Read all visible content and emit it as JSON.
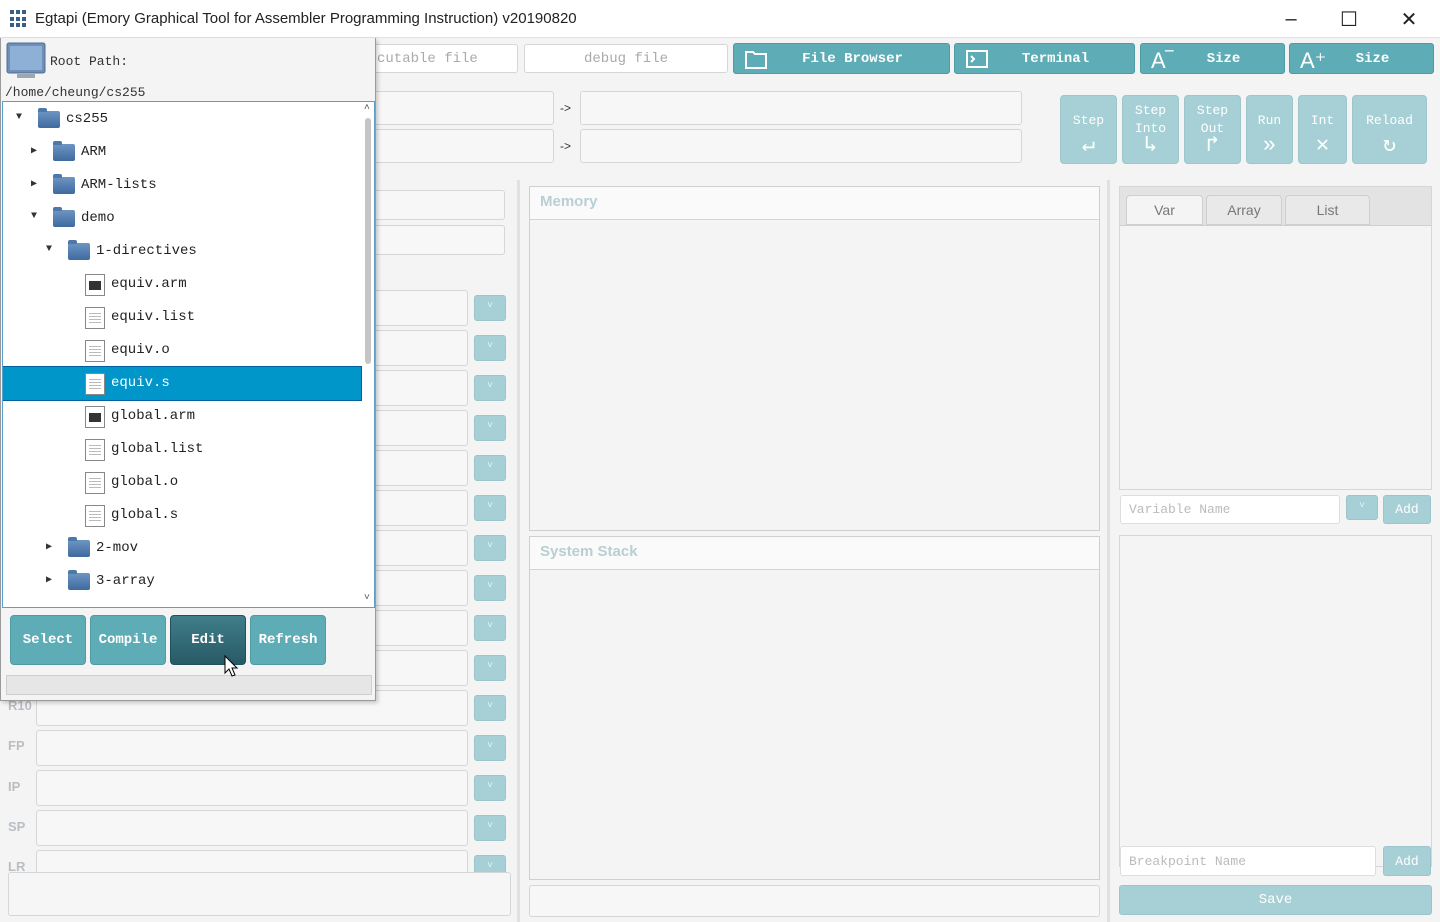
{
  "window": {
    "title": "Egtapi (Emory Graphical Tool for Assembler Programming Instruction) v20190820"
  },
  "toolbar": {
    "executable_placeholder": "cutable file",
    "debug_placeholder": "debug file",
    "file_browser": "File Browser",
    "terminal": "Terminal",
    "size_down": "Size",
    "size_up": "Size"
  },
  "arrows": [
    "->",
    "->"
  ],
  "controls": {
    "step": "Step",
    "step_into": "Step Into",
    "step_out": "Step Out",
    "run": "Run",
    "int": "Int",
    "reload": "Reload"
  },
  "registers": [
    "R10",
    "FP",
    "IP",
    "SP",
    "LR"
  ],
  "memory": {
    "title": "Memory"
  },
  "stack": {
    "title": "System Stack"
  },
  "watch": {
    "tabs": [
      "Var",
      "Array",
      "List"
    ],
    "variable_placeholder": "Variable Name",
    "add_label": "Add",
    "breakpoint_placeholder": "Breakpoint Name",
    "add_bp_label": "Add",
    "save_label": "Save"
  },
  "filebrowser": {
    "root_label": "Root Path:",
    "root_path": "/home/cheung/cs255",
    "tree": [
      {
        "label": "cs255",
        "type": "folder",
        "depth": 0,
        "expanded": true
      },
      {
        "label": "ARM",
        "type": "folder",
        "depth": 1,
        "expanded": false
      },
      {
        "label": "ARM-lists",
        "type": "folder",
        "depth": 1,
        "expanded": false
      },
      {
        "label": "demo",
        "type": "folder",
        "depth": 1,
        "expanded": true
      },
      {
        "label": "1-directives",
        "type": "folder",
        "depth": 2,
        "expanded": true
      },
      {
        "label": "equiv.arm",
        "type": "exe",
        "depth": 3
      },
      {
        "label": "equiv.list",
        "type": "file",
        "depth": 3
      },
      {
        "label": "equiv.o",
        "type": "file",
        "depth": 3
      },
      {
        "label": "equiv.s",
        "type": "file",
        "depth": 3,
        "selected": true
      },
      {
        "label": "global.arm",
        "type": "exe",
        "depth": 3
      },
      {
        "label": "global.list",
        "type": "file",
        "depth": 3
      },
      {
        "label": "global.o",
        "type": "file",
        "depth": 3
      },
      {
        "label": "global.s",
        "type": "file",
        "depth": 3
      },
      {
        "label": "2-mov",
        "type": "folder",
        "depth": 2,
        "expanded": false
      },
      {
        "label": "3-array",
        "type": "folder",
        "depth": 2,
        "expanded": false
      }
    ],
    "buttons": {
      "select": "Select",
      "compile": "Compile",
      "edit": "Edit",
      "refresh": "Refresh"
    }
  },
  "colors": {
    "accent": "#5eacb6",
    "selection": "#0096c9",
    "disabled": "#a7d0d6"
  }
}
